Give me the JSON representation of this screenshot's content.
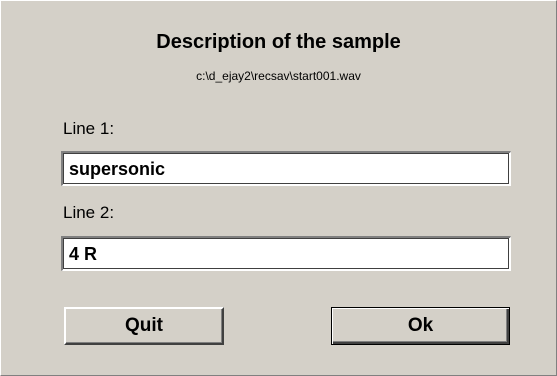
{
  "dialog": {
    "title": "Description of the sample",
    "file_path": "c:\\d_ejay2\\recsav\\start001.wav"
  },
  "fields": {
    "line1": {
      "label": "Line 1:",
      "value": "supersonic"
    },
    "line2": {
      "label": "Line 2:",
      "value": "4 R"
    }
  },
  "buttons": {
    "quit_label": "Quit",
    "ok_label": "Ok"
  }
}
